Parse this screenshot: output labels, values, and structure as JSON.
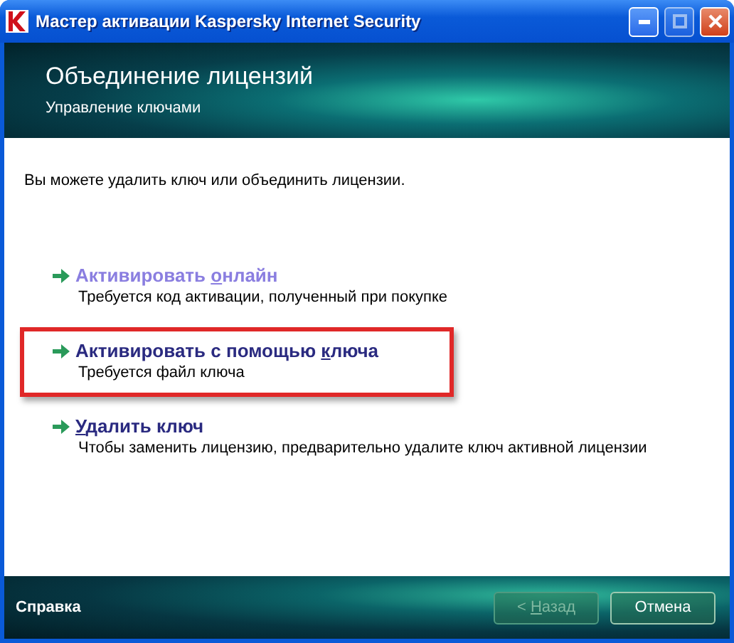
{
  "window": {
    "title": "Мастер активации Kaspersky Internet Security"
  },
  "header": {
    "title": "Объединение лицензий",
    "subtitle": "Управление ключами"
  },
  "intro": "Вы можете удалить ключ или объединить лицензии.",
  "options": [
    {
      "label": {
        "before": "Активировать ",
        "key": "о",
        "after": "нлайн"
      },
      "description": "Требуется код активации, полученный при покупке",
      "visited": true,
      "highlighted": false
    },
    {
      "label": {
        "before": "Активировать с помощью ",
        "key": "к",
        "after": "люча"
      },
      "description": "Требуется файл ключа",
      "visited": false,
      "highlighted": true
    },
    {
      "label": {
        "key": "У",
        "after": "далить ключ"
      },
      "description": "Чтобы заменить лицензию, предварительно удалите ключ активной лицензии",
      "visited": false,
      "highlighted": false
    }
  ],
  "footer": {
    "help": "Справка",
    "buttons": [
      {
        "label": {
          "before": "< ",
          "key": "Н",
          "after": "азад"
        },
        "disabled": true
      },
      {
        "label": {
          "after": "Отмена"
        },
        "disabled": false
      }
    ]
  }
}
